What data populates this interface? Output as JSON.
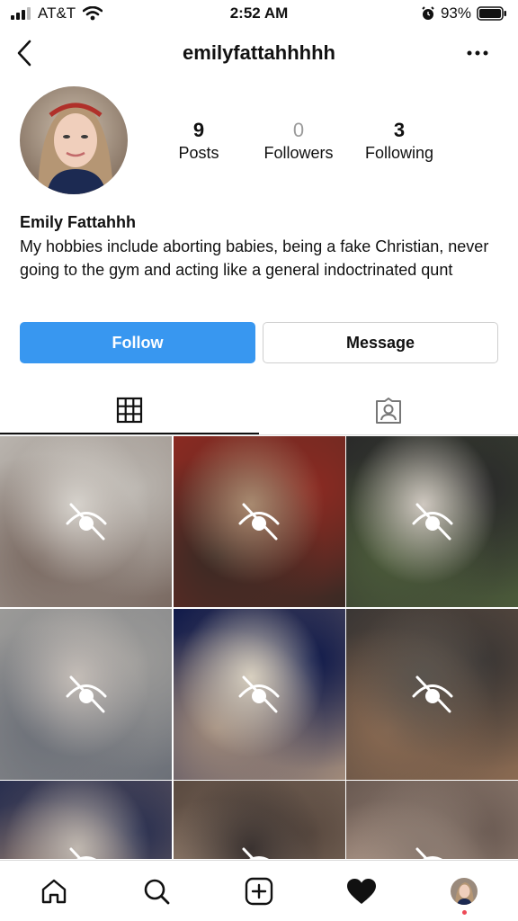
{
  "status_bar": {
    "carrier": "AT&T",
    "time": "2:52 AM",
    "battery_pct": "93%"
  },
  "header": {
    "username": "emilyfattahhhhh"
  },
  "profile": {
    "stats": {
      "posts_count": "9",
      "posts_label": "Posts",
      "followers_count": "0",
      "followers_label": "Followers",
      "following_count": "3",
      "following_label": "Following"
    },
    "full_name": "Emily Fattahhh",
    "bio": "My hobbies include aborting babies, being a fake Christian, never going to the gym and acting like a general indoctrinated qunt",
    "follow_label": "Follow",
    "message_label": "Message"
  },
  "colors": {
    "accent": "#3897f0",
    "notification": "#ed4956"
  },
  "tabs": [
    "grid-icon",
    "tagged-icon"
  ],
  "grid_tiles": [
    {
      "state": "hidden",
      "palette": [
        "#b9b4ae",
        "#7a6a62",
        "#d6d2cc"
      ]
    },
    {
      "state": "hidden",
      "palette": [
        "#8a2a22",
        "#3a2a24",
        "#a88a70"
      ]
    },
    {
      "state": "hidden",
      "palette": [
        "#2a2a2a",
        "#4b5a3a",
        "#cfc8c0"
      ]
    },
    {
      "state": "hidden",
      "palette": [
        "#9b9a98",
        "#6c7078",
        "#c4bdb7"
      ]
    },
    {
      "state": "hidden",
      "palette": [
        "#101a4a",
        "#a08a7a",
        "#d8d0c0"
      ]
    },
    {
      "state": "hidden",
      "palette": [
        "#3a3634",
        "#8a6a52",
        "#5a544e"
      ]
    },
    {
      "state": "hidden",
      "palette": [
        "#2a3050",
        "#9a8070",
        "#c0b8b0"
      ]
    },
    {
      "state": "hidden",
      "palette": [
        "#5a4a40",
        "#a08a78",
        "#3a3230"
      ]
    },
    {
      "state": "hidden",
      "palette": [
        "#6a5a52",
        "#c0a898",
        "#8a7a70"
      ]
    }
  ],
  "nav": [
    "home-icon",
    "search-icon",
    "new-post-icon",
    "activity-heart-icon",
    "profile-avatar"
  ]
}
